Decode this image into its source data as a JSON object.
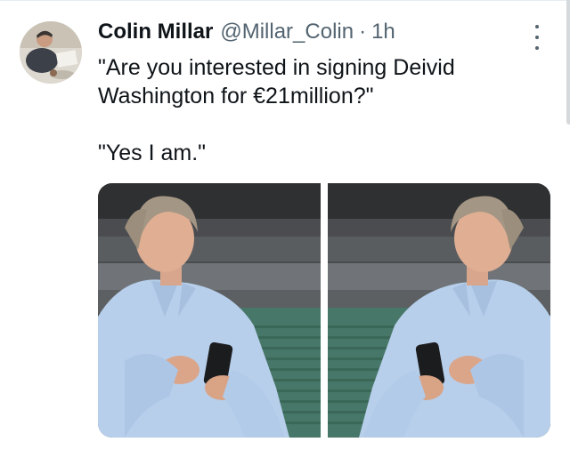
{
  "tweet": {
    "author": {
      "display_name": "Colin Millar",
      "handle": "@Millar_Colin",
      "avatar_icon": "profile-photo"
    },
    "separator": "·",
    "time_ago": "1h",
    "text_lines": [
      "\"Are you interested in signing Deivid",
      "Washington for €21million?\"",
      "\"Yes I am.\""
    ],
    "more_icon": "more-vertical-icon",
    "media": {
      "type": "two-photo-grid",
      "count": 2
    }
  },
  "colors": {
    "text_primary": "#0f1419",
    "text_secondary": "#536471",
    "shirt": "#b8d0ec",
    "background": "#ffffff"
  }
}
